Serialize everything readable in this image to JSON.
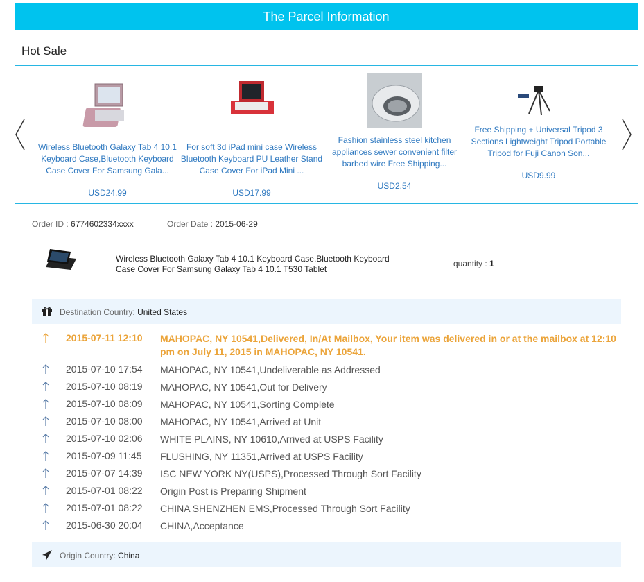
{
  "header": {
    "title": "The Parcel Information"
  },
  "hot_sale": {
    "title": "Hot Sale",
    "products": [
      {
        "name": "Wireless Bluetooth Galaxy Tab 4 10.1 Keyboard Case,Bluetooth Keyboard Case Cover For Samsung Gala...",
        "price": "USD24.99"
      },
      {
        "name": "For soft 3d iPad mini case Wireless Bluetooth Keyboard PU Leather Stand Case Cover For iPad Mini ...",
        "price": "USD17.99"
      },
      {
        "name": "Fashion stainless steel kitchen appliances sewer convenient filter barbed wire Free Shipping...",
        "price": "USD2.54"
      },
      {
        "name": "Free Shipping + Universal Tripod 3 Sections Lightweight Tripod Portable Tripod for Fuji Canon Son...",
        "price": "USD9.99"
      }
    ]
  },
  "order": {
    "id_label": "Order ID : ",
    "id_value": "6774602334xxxx",
    "date_label": "Order Date : ",
    "date_value": "2015-06-29",
    "item_title": "Wireless Bluetooth Galaxy Tab 4 10.1 Keyboard Case,Bluetooth Keyboard Case Cover For Samsung Galaxy Tab 4 10.1 T530 Tablet",
    "quantity_label": "quantity : ",
    "quantity_value": "1"
  },
  "destination": {
    "label": "Destination Country: ",
    "value": "United States"
  },
  "origin": {
    "label": "Origin Country: ",
    "value": "China"
  },
  "tracking": [
    {
      "time": "2015-07-11 12:10",
      "desc": "MAHOPAC, NY 10541,Delivered, In/At Mailbox, Your item was delivered in or at the mailbox at 12:10 pm on July 11, 2015 in MAHOPAC, NY 10541."
    },
    {
      "time": "2015-07-10 17:54",
      "desc": "MAHOPAC, NY 10541,Undeliverable as Addressed"
    },
    {
      "time": "2015-07-10 08:19",
      "desc": "MAHOPAC, NY 10541,Out for Delivery"
    },
    {
      "time": "2015-07-10 08:09",
      "desc": "MAHOPAC, NY 10541,Sorting Complete"
    },
    {
      "time": "2015-07-10 08:00",
      "desc": "MAHOPAC, NY 10541,Arrived at Unit"
    },
    {
      "time": "2015-07-10 02:06",
      "desc": "WHITE PLAINS, NY 10610,Arrived at USPS Facility"
    },
    {
      "time": "2015-07-09 11:45",
      "desc": "FLUSHING, NY 11351,Arrived at USPS Facility"
    },
    {
      "time": "2015-07-07 14:39",
      "desc": "ISC NEW YORK NY(USPS),Processed Through Sort Facility"
    },
    {
      "time": "2015-07-01 08:22",
      "desc": "Origin Post is Preparing Shipment"
    },
    {
      "time": "2015-07-01 08:22",
      "desc": "CHINA SHENZHEN EMS,Processed Through Sort Facility"
    },
    {
      "time": "2015-06-30 20:04",
      "desc": "CHINA,Acceptance"
    }
  ],
  "icons": {
    "carousel_prev": "chevron-left-icon",
    "carousel_next": "chevron-right-icon",
    "destination": "gift-icon",
    "origin": "paper-plane-icon",
    "event": "arrow-up-icon"
  },
  "colors": {
    "accent": "#00c3ee",
    "link": "#2f79c0",
    "highlight": "#eba43a",
    "panel": "#ecf5fd"
  }
}
